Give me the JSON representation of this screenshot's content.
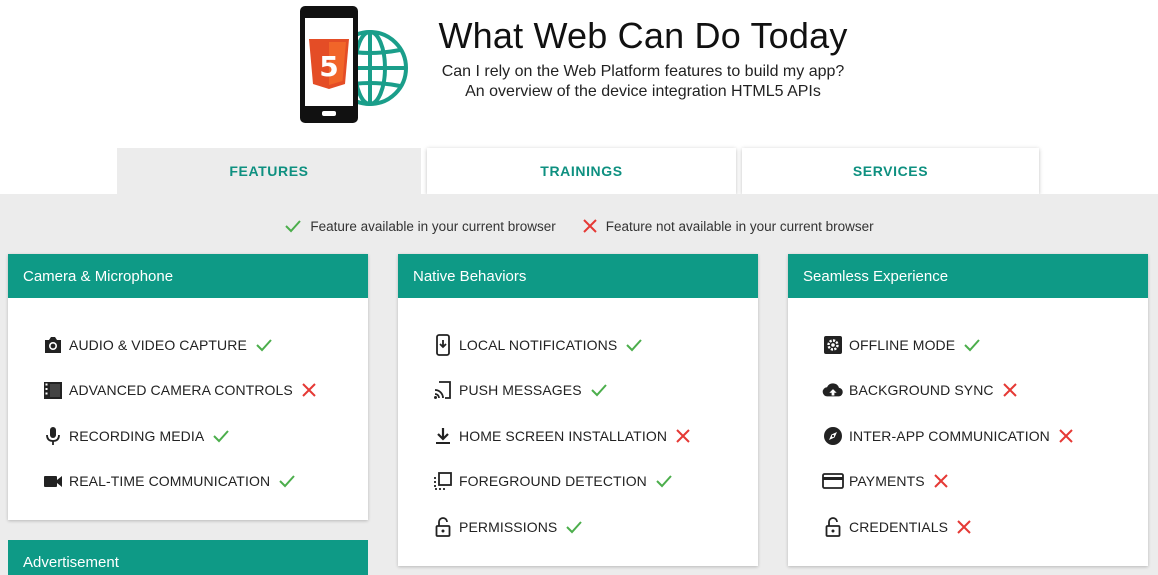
{
  "header": {
    "title": "What Web Can Do Today",
    "subtitle_line1": "Can I rely on the Web Platform features to build my app?",
    "subtitle_line2": "An overview of the device integration HTML5 APIs",
    "logo_badge": "5"
  },
  "tabs": [
    {
      "label": "FEATURES",
      "active": true
    },
    {
      "label": "TRAININGS",
      "active": false
    },
    {
      "label": "SERVICES",
      "active": false
    }
  ],
  "legend": {
    "available": "Feature available in your current browser",
    "not_available": "Feature not available in your current browser"
  },
  "colors": {
    "accent": "#0e9a86",
    "check": "#4cae4c",
    "cross": "#e53935",
    "background": "#ececec"
  },
  "cards": [
    {
      "title": "Camera & Microphone",
      "items": [
        {
          "label": "AUDIO & VIDEO CAPTURE",
          "icon": "camera-icon",
          "available": true
        },
        {
          "label": "ADVANCED CAMERA CONTROLS",
          "icon": "film-icon",
          "available": false
        },
        {
          "label": "RECORDING MEDIA",
          "icon": "microphone-icon",
          "available": true
        },
        {
          "label": "REAL-TIME COMMUNICATION",
          "icon": "videocam-icon",
          "available": true
        }
      ]
    },
    {
      "title": "Native Behaviors",
      "items": [
        {
          "label": "LOCAL NOTIFICATIONS",
          "icon": "phone-download-icon",
          "available": true
        },
        {
          "label": "PUSH MESSAGES",
          "icon": "cast-icon",
          "available": true
        },
        {
          "label": "HOME SCREEN INSTALLATION",
          "icon": "download-icon",
          "available": false
        },
        {
          "label": "FOREGROUND DETECTION",
          "icon": "select-window-icon",
          "available": true
        },
        {
          "label": "PERMISSIONS",
          "icon": "lock-open-icon",
          "available": true
        }
      ]
    },
    {
      "title": "Seamless Experience",
      "items": [
        {
          "label": "OFFLINE MODE",
          "icon": "settings-icon",
          "available": true
        },
        {
          "label": "BACKGROUND SYNC",
          "icon": "cloud-upload-icon",
          "available": false
        },
        {
          "label": "INTER-APP COMMUNICATION",
          "icon": "compass-icon",
          "available": false
        },
        {
          "label": "PAYMENTS",
          "icon": "credit-card-icon",
          "available": false
        },
        {
          "label": "CREDENTIALS",
          "icon": "lock-open-icon",
          "available": false
        }
      ]
    },
    {
      "title": "Advertisement",
      "items": []
    }
  ]
}
